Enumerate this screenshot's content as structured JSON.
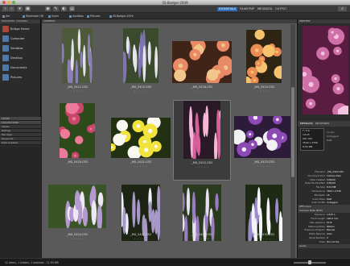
{
  "window": {
    "title": "SS-Badger-2009"
  },
  "toolbar": {
    "workspaces": [
      {
        "label": "ESSENTIALS",
        "active": true
      },
      {
        "label": "FILMSTRIP",
        "active": false
      },
      {
        "label": "METADATA",
        "active": false
      },
      {
        "label": "OUTPUT",
        "active": false
      }
    ]
  },
  "path_bar": [
    "Jim",
    "Macintosh HD",
    "Users",
    "Sandbox",
    "Pictures",
    "SS-Badger-2009"
  ],
  "left_panel": {
    "tabs": [
      "FAVORITES",
      "FOLDERS"
    ],
    "favorites": [
      {
        "label": "Bridge Home",
        "icon": "bridge-home-icon"
      },
      {
        "label": "Computer",
        "icon": "computer-icon"
      },
      {
        "label": "Sandbox",
        "icon": "home-folder-icon"
      },
      {
        "label": "Desktop",
        "icon": "desktop-icon"
      },
      {
        "label": "Documents",
        "icon": "documents-folder-icon"
      },
      {
        "label": "Pictures",
        "icon": "pictures-folder-icon"
      }
    ],
    "filter_rows": [
      "FILTER",
      "COLLECTIONS",
      "Labels",
      "Ratings",
      "File Type",
      "Keywords",
      "Date Created"
    ]
  },
  "content": {
    "header": "CONTENT",
    "selected_index": 10,
    "thumbnails": [
      {
        "name": "_MG_5411.CR2",
        "colors": [
          "#4c5a3a",
          "#8c7fb8",
          "#e6e0ea"
        ]
      },
      {
        "name": "_MG_5415.CR2",
        "colors": [
          "#3a4a2c",
          "#7f73b0",
          "#e8e4ee"
        ]
      },
      {
        "name": "_MG_5416.CR2",
        "colors": [
          "#402418",
          "#e88a66",
          "#f2c58a"
        ]
      },
      {
        "name": "_MG_5419.CR2",
        "colors": [
          "#2e2414",
          "#ea8c54",
          "#f6c26e"
        ]
      },
      {
        "name": "_MG_5420.CR2",
        "colors": [
          "#2c4a1a",
          "#c8456c",
          "#ee7a9a"
        ]
      },
      {
        "name": "_MG_5421.CR2",
        "colors": [
          "#223012",
          "#f2e23c",
          "#f8f8f0"
        ]
      },
      {
        "name": "_MG_5422.CR2",
        "colors": [
          "#2a1a28",
          "#d6609a",
          "#f4b8d4"
        ]
      },
      {
        "name": "_MG_5423.CR2",
        "colors": [
          "#2c1c3a",
          "#8c4ab4",
          "#f2f2f2"
        ]
      },
      {
        "name": "_MG_5424.CR2",
        "colors": [
          "#3a5428",
          "#b49ad0",
          "#eee8f4"
        ]
      },
      {
        "name": "_MG_5427.CR2",
        "colors": [
          "#1c2414",
          "#a898c8",
          "#f0f0f8"
        ]
      },
      {
        "name": "_MG_5428.CR2",
        "colors": [
          "#2a3a1e",
          "#9a7cc0",
          "#e6e0f0"
        ]
      },
      {
        "name": "_MG_5432.CR2",
        "colors": [
          "#1e2a14",
          "#9a8ad0",
          "#f4f4fa"
        ]
      }
    ]
  },
  "preview": {
    "tab": "PREVIEW",
    "colors": [
      "#5a1c40",
      "#d070a8",
      "#f2c4e0"
    ]
  },
  "metadata_panel": {
    "tabs": [
      "METADATA",
      "KEYWORDS"
    ],
    "camera": {
      "aperture": "f / 5.6",
      "exposure": "1/125",
      "iso": "ISO 100",
      "size": "3504 x 2336",
      "mb": "8.54 MB",
      "dpi": "72 ppi"
    },
    "camera_right": [
      "Untagged",
      "RGB"
    ],
    "rows": [
      {
        "k": "Filename",
        "v": "_MG_5422.CR2"
      },
      {
        "k": "Document Kind",
        "v": "Camera Raw"
      },
      {
        "k": "Date Created",
        "v": "5/30/09"
      },
      {
        "k": "Date File Modified",
        "v": "5/30/09"
      },
      {
        "k": "File Size",
        "v": "8.54 MB"
      },
      {
        "k": "Dimensions",
        "v": "3504 x 2336"
      },
      {
        "k": "Bit Depth",
        "v": "16"
      },
      {
        "k": "Color Mode",
        "v": "RGB"
      },
      {
        "k": "Color Profile",
        "v": "Untagged"
      }
    ],
    "section_iptc": "IPTC Core",
    "section_exif": "Camera Data (Exif)",
    "exif_rows": [
      {
        "k": "Exposure",
        "v": "1/125 s"
      },
      {
        "k": "Focal Length",
        "v": "100.0 mm"
      },
      {
        "k": "Max Aperture",
        "v": "f/2.8"
      },
      {
        "k": "Metering Mode",
        "v": "Pattern"
      },
      {
        "k": "Exposure Program",
        "v": "Manual"
      },
      {
        "k": "White Balance",
        "v": "Auto"
      },
      {
        "k": "Serial Number",
        "v": "0"
      },
      {
        "k": "Flash",
        "v": "Did not fire"
      }
    ],
    "footer": "Audio"
  },
  "status": {
    "text": "12 items, 1 hidden, 1 selected - 11.95 MB"
  }
}
